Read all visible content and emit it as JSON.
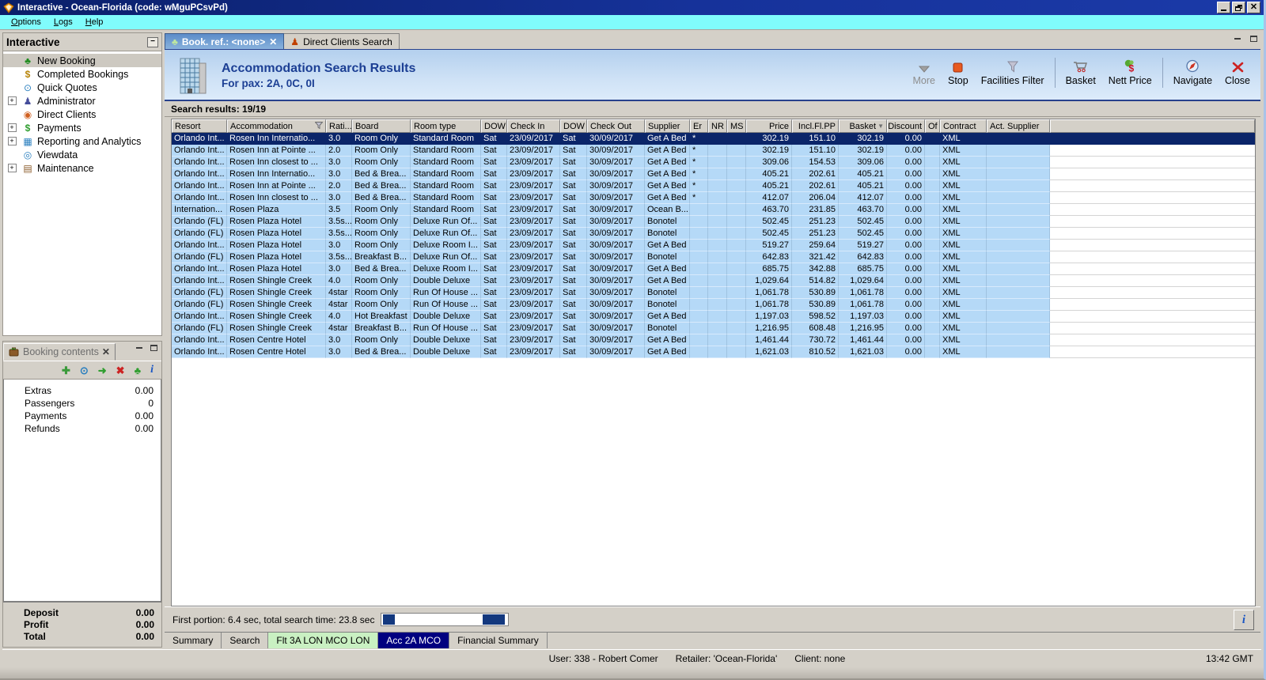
{
  "window": {
    "title": "Interactive - Ocean-Florida (code: wMguPCsvPd)"
  },
  "menu": {
    "items": [
      "Options",
      "Logs",
      "Help"
    ]
  },
  "sidebar": {
    "title": "Interactive",
    "items": [
      {
        "label": "New Booking",
        "icon": "palm-tree-icon",
        "expand": false,
        "selected": true
      },
      {
        "label": "Completed Bookings",
        "icon": "money-palm-icon",
        "expand": false,
        "selected": false
      },
      {
        "label": "Quick Quotes",
        "icon": "clock-icon",
        "expand": false,
        "selected": false
      },
      {
        "label": "Administrator",
        "icon": "administrator-icon",
        "expand": true,
        "selected": false
      },
      {
        "label": "Direct Clients",
        "icon": "globe-icon",
        "expand": false,
        "selected": false
      },
      {
        "label": "Payments",
        "icon": "payments-icon",
        "expand": true,
        "selected": false
      },
      {
        "label": "Reporting and Analytics",
        "icon": "report-icon",
        "expand": true,
        "selected": false
      },
      {
        "label": "Viewdata",
        "icon": "viewdata-icon",
        "expand": false,
        "selected": false
      },
      {
        "label": "Maintenance",
        "icon": "toolbox-icon",
        "expand": true,
        "selected": false
      }
    ]
  },
  "booking_contents": {
    "title": "Booking contents",
    "tools": [
      "add-icon",
      "quote-icon",
      "move-to-basket-icon",
      "delete-icon",
      "holiday-icon",
      "info-icon"
    ],
    "rows": [
      {
        "label": "Extras",
        "value": "0.00"
      },
      {
        "label": "Passengers",
        "value": "0"
      },
      {
        "label": "Payments",
        "value": "0.00"
      },
      {
        "label": "Refunds",
        "value": "0.00"
      }
    ],
    "totals": [
      {
        "label": "Deposit",
        "value": "0.00"
      },
      {
        "label": "Profit",
        "value": "0.00"
      },
      {
        "label": "Total",
        "value": "0.00"
      }
    ]
  },
  "tabs": [
    {
      "label": "Book. ref.: <none>",
      "icon": "palm-tree-icon",
      "active": true,
      "closable": true
    },
    {
      "label": "Direct Clients Search",
      "icon": "person-icon",
      "active": false,
      "closable": false
    }
  ],
  "header": {
    "title": "Accommodation Search Results",
    "subtitle": "For pax: 2A, 0C, 0I"
  },
  "toolbar": {
    "more": "More",
    "stop": "Stop",
    "facilities_filter": "Facilities Filter",
    "basket": "Basket",
    "nett_price": "Nett Price",
    "navigate": "Navigate",
    "close": "Close"
  },
  "results": {
    "label": "Search results: 19/19",
    "columns": [
      "Resort",
      "Accommodation",
      "Rati...",
      "Board",
      "Room type",
      "DOW",
      "Check In",
      "DOW",
      "Check Out",
      "Supplier",
      "Er",
      "NR",
      "MS",
      "Price",
      "Incl.Fl.PP",
      "Basket",
      "Discount",
      "Of",
      "Contract",
      "Act. Supplier"
    ],
    "selected_row": 0,
    "rows": [
      [
        "Orlando Int...",
        "Rosen Inn Internatio...",
        "3.0",
        "Room Only",
        "Standard Room",
        "Sat",
        "23/09/2017",
        "Sat",
        "30/09/2017",
        "Get A Bed",
        "*",
        "",
        "",
        "302.19",
        "151.10",
        "302.19",
        "0.00",
        "",
        "XML",
        ""
      ],
      [
        "Orlando Int...",
        "Rosen Inn at Pointe ...",
        "2.0",
        "Room Only",
        "Standard Room",
        "Sat",
        "23/09/2017",
        "Sat",
        "30/09/2017",
        "Get A Bed",
        "*",
        "",
        "",
        "302.19",
        "151.10",
        "302.19",
        "0.00",
        "",
        "XML",
        ""
      ],
      [
        "Orlando Int...",
        "Rosen Inn closest to ...",
        "3.0",
        "Room Only",
        "Standard Room",
        "Sat",
        "23/09/2017",
        "Sat",
        "30/09/2017",
        "Get A Bed",
        "*",
        "",
        "",
        "309.06",
        "154.53",
        "309.06",
        "0.00",
        "",
        "XML",
        ""
      ],
      [
        "Orlando Int...",
        "Rosen Inn Internatio...",
        "3.0",
        "Bed & Brea...",
        "Standard Room",
        "Sat",
        "23/09/2017",
        "Sat",
        "30/09/2017",
        "Get A Bed",
        "*",
        "",
        "",
        "405.21",
        "202.61",
        "405.21",
        "0.00",
        "",
        "XML",
        ""
      ],
      [
        "Orlando Int...",
        "Rosen Inn at Pointe ...",
        "2.0",
        "Bed & Brea...",
        "Standard Room",
        "Sat",
        "23/09/2017",
        "Sat",
        "30/09/2017",
        "Get A Bed",
        "*",
        "",
        "",
        "405.21",
        "202.61",
        "405.21",
        "0.00",
        "",
        "XML",
        ""
      ],
      [
        "Orlando Int...",
        "Rosen Inn closest to ...",
        "3.0",
        "Bed & Brea...",
        "Standard Room",
        "Sat",
        "23/09/2017",
        "Sat",
        "30/09/2017",
        "Get A Bed",
        "*",
        "",
        "",
        "412.07",
        "206.04",
        "412.07",
        "0.00",
        "",
        "XML",
        ""
      ],
      [
        "Internation...",
        "Rosen Plaza",
        "3.5",
        "Room Only",
        "Standard Room",
        "Sat",
        "23/09/2017",
        "Sat",
        "30/09/2017",
        "Ocean B...",
        "",
        "",
        "",
        "463.70",
        "231.85",
        "463.70",
        "0.00",
        "",
        "XML",
        ""
      ],
      [
        "Orlando (FL)",
        "Rosen Plaza Hotel",
        "3.5s...",
        "Room Only",
        "Deluxe Run Of...",
        "Sat",
        "23/09/2017",
        "Sat",
        "30/09/2017",
        "Bonotel",
        "",
        "",
        "",
        "502.45",
        "251.23",
        "502.45",
        "0.00",
        "",
        "XML",
        ""
      ],
      [
        "Orlando (FL)",
        "Rosen Plaza Hotel",
        "3.5s...",
        "Room Only",
        "Deluxe Run Of...",
        "Sat",
        "23/09/2017",
        "Sat",
        "30/09/2017",
        "Bonotel",
        "",
        "",
        "",
        "502.45",
        "251.23",
        "502.45",
        "0.00",
        "",
        "XML",
        ""
      ],
      [
        "Orlando Int...",
        "Rosen Plaza Hotel",
        "3.0",
        "Room Only",
        "Deluxe Room I...",
        "Sat",
        "23/09/2017",
        "Sat",
        "30/09/2017",
        "Get A Bed",
        "",
        "",
        "",
        "519.27",
        "259.64",
        "519.27",
        "0.00",
        "",
        "XML",
        ""
      ],
      [
        "Orlando (FL)",
        "Rosen Plaza Hotel",
        "3.5s...",
        "Breakfast B...",
        "Deluxe Run Of...",
        "Sat",
        "23/09/2017",
        "Sat",
        "30/09/2017",
        "Bonotel",
        "",
        "",
        "",
        "642.83",
        "321.42",
        "642.83",
        "0.00",
        "",
        "XML",
        ""
      ],
      [
        "Orlando Int...",
        "Rosen Plaza Hotel",
        "3.0",
        "Bed & Brea...",
        "Deluxe Room I...",
        "Sat",
        "23/09/2017",
        "Sat",
        "30/09/2017",
        "Get A Bed",
        "",
        "",
        "",
        "685.75",
        "342.88",
        "685.75",
        "0.00",
        "",
        "XML",
        ""
      ],
      [
        "Orlando Int...",
        "Rosen Shingle Creek",
        "4.0",
        "Room Only",
        "Double Deluxe",
        "Sat",
        "23/09/2017",
        "Sat",
        "30/09/2017",
        "Get A Bed",
        "",
        "",
        "",
        "1,029.64",
        "514.82",
        "1,029.64",
        "0.00",
        "",
        "XML",
        ""
      ],
      [
        "Orlando (FL)",
        "Rosen Shingle Creek",
        "4star",
        "Room Only",
        "Run Of House ...",
        "Sat",
        "23/09/2017",
        "Sat",
        "30/09/2017",
        "Bonotel",
        "",
        "",
        "",
        "1,061.78",
        "530.89",
        "1,061.78",
        "0.00",
        "",
        "XML",
        ""
      ],
      [
        "Orlando (FL)",
        "Rosen Shingle Creek",
        "4star",
        "Room Only",
        "Run Of House ...",
        "Sat",
        "23/09/2017",
        "Sat",
        "30/09/2017",
        "Bonotel",
        "",
        "",
        "",
        "1,061.78",
        "530.89",
        "1,061.78",
        "0.00",
        "",
        "XML",
        ""
      ],
      [
        "Orlando Int...",
        "Rosen Shingle Creek",
        "4.0",
        "Hot Breakfast",
        "Double Deluxe",
        "Sat",
        "23/09/2017",
        "Sat",
        "30/09/2017",
        "Get A Bed",
        "",
        "",
        "",
        "1,197.03",
        "598.52",
        "1,197.03",
        "0.00",
        "",
        "XML",
        ""
      ],
      [
        "Orlando (FL)",
        "Rosen Shingle Creek",
        "4star",
        "Breakfast B...",
        "Run Of House ...",
        "Sat",
        "23/09/2017",
        "Sat",
        "30/09/2017",
        "Bonotel",
        "",
        "",
        "",
        "1,216.95",
        "608.48",
        "1,216.95",
        "0.00",
        "",
        "XML",
        ""
      ],
      [
        "Orlando Int...",
        "Rosen Centre Hotel",
        "3.0",
        "Room Only",
        "Double Deluxe",
        "Sat",
        "23/09/2017",
        "Sat",
        "30/09/2017",
        "Get A Bed",
        "",
        "",
        "",
        "1,461.44",
        "730.72",
        "1,461.44",
        "0.00",
        "",
        "XML",
        ""
      ],
      [
        "Orlando Int...",
        "Rosen Centre Hotel",
        "3.0",
        "Bed & Brea...",
        "Double Deluxe",
        "Sat",
        "23/09/2017",
        "Sat",
        "30/09/2017",
        "Get A Bed",
        "",
        "",
        "",
        "1,621.03",
        "810.52",
        "1,621.03",
        "0.00",
        "",
        "XML",
        ""
      ]
    ]
  },
  "footer": {
    "search_time": "First portion: 6.4 sec, total search time: 23.8 sec",
    "tabs": [
      {
        "label": "Summary",
        "style": "plain"
      },
      {
        "label": "Search",
        "style": "plain"
      },
      {
        "label": "Flt 3A LON MCO LON",
        "style": "flight"
      },
      {
        "label": "Acc 2A MCO",
        "style": "active"
      },
      {
        "label": "Financial Summary",
        "style": "plain"
      }
    ]
  },
  "status": {
    "user": "User: 338 - Robert Comer",
    "retailer": "Retailer: 'Ocean-Florida'",
    "client": "Client: none",
    "time": "13:42 GMT"
  }
}
